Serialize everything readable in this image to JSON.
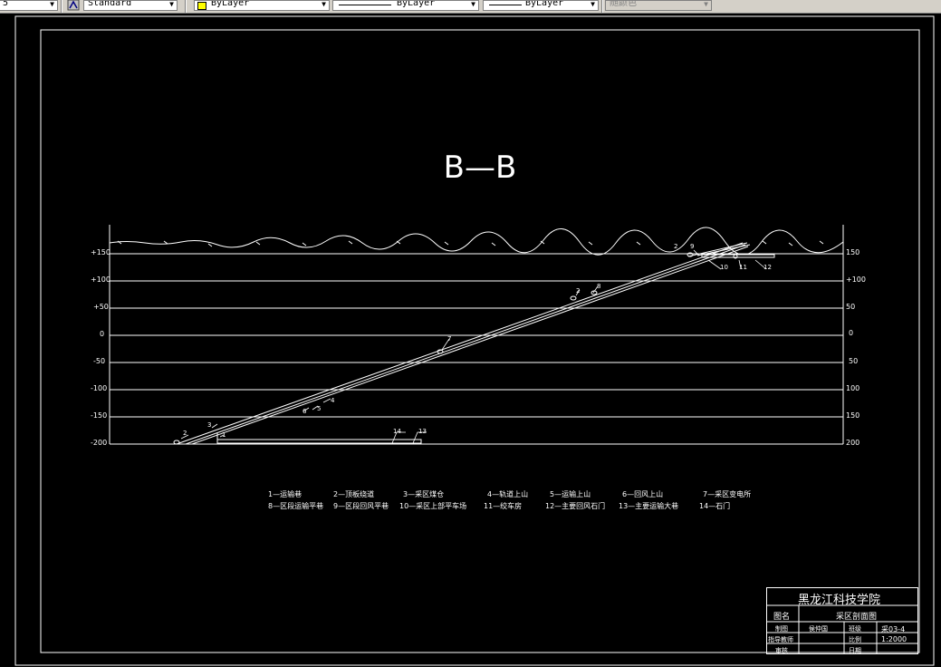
{
  "toolbar": {
    "layer_partial": "5",
    "text_style": "Standard",
    "color": "ByLayer",
    "linetype": "ByLayer",
    "lineweight": "ByLayer",
    "plot_style": "随颜色",
    "color_swatch": "#ffff00"
  },
  "drawing": {
    "title": "B—B",
    "left_elevations": [
      "+150",
      "+100",
      "+50",
      "0",
      "-50",
      "-100",
      "-150",
      "-200"
    ],
    "right_elevations": [
      "150",
      "+100",
      "50",
      "0",
      "50",
      "100",
      "150",
      "200"
    ],
    "callouts": [
      "2",
      "9",
      "10",
      "11",
      "12",
      "2",
      "8",
      "7",
      "4",
      "5",
      "6",
      "2",
      "3",
      "1",
      "14",
      "13"
    ]
  },
  "legend": [
    "1—运输巷",
    "2—顶板绕道",
    "3—采区煤仓",
    "4—轨道上山",
    "5—运输上山",
    "6—回风上山",
    "7—采区变电所",
    "8—区段运输平巷",
    "9—区段回风平巷",
    "10—采区上部平车场",
    "11—绞车房",
    "12—主要回风石门",
    "13—主要运输大巷",
    "14—石门"
  ],
  "title_block": {
    "school": "黑龙江科技学院",
    "drawing_name_label": "图名",
    "drawing_name": "采区剖面图",
    "drawn_label": "制图",
    "drawn_by": "侯仲国",
    "class_label": "班级",
    "drawing_no": "采03-4",
    "advisor_label": "指导教师",
    "scale_label": "比例",
    "scale": "1:2000",
    "review_label": "审核",
    "date_label": "日期"
  }
}
